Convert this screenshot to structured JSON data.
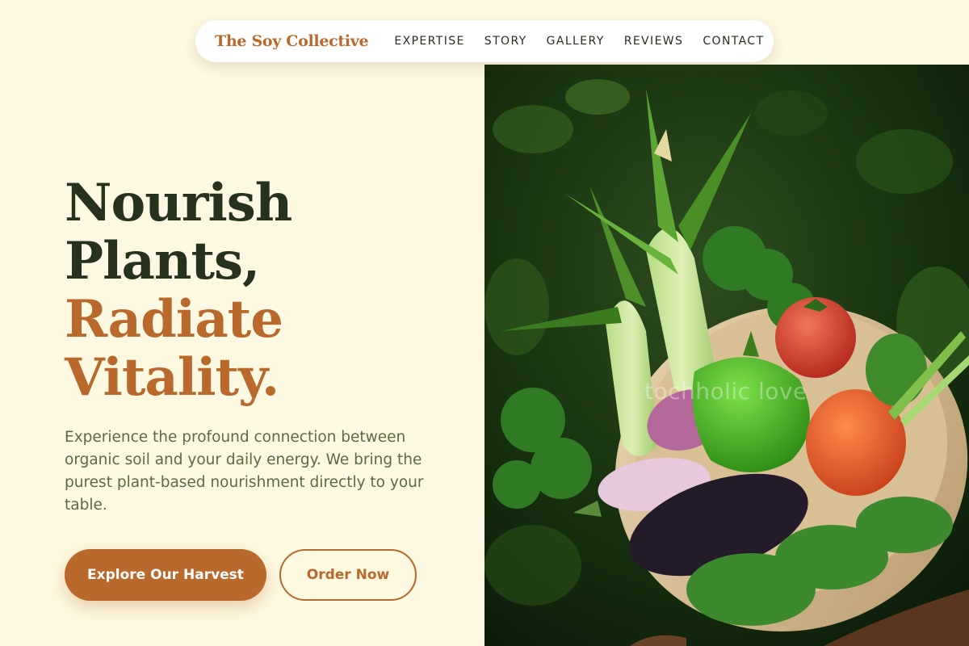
{
  "brand": {
    "name": "The Soy Collective"
  },
  "nav": {
    "links": [
      "EXPERTISE",
      "STORY",
      "GALLERY",
      "REVIEWS",
      "CONTACT"
    ]
  },
  "hero": {
    "title_line1": "Nourish",
    "title_line2": "Plants,",
    "title_line3": "Radiate",
    "title_line4": "Vitality.",
    "description": "Experience the profound connection between organic soil and your daily energy. We bring the purest plant-based nourishment directly to your table.",
    "primary_cta": "Explore Our Harvest",
    "secondary_cta": "Order Now"
  },
  "image": {
    "watermark": "tochholic love"
  },
  "colors": {
    "background": "#fdf8e1",
    "accent": "#b8692b",
    "heading_dark": "#26321d",
    "body_text": "#5c6a47"
  }
}
